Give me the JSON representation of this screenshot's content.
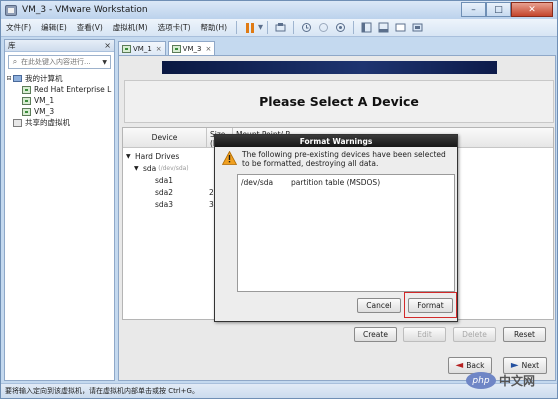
{
  "window": {
    "title": "VM_3 - VMware Workstation",
    "min_glyph": "–",
    "max_glyph": "□",
    "close_glyph": "✕"
  },
  "menu": [
    "文件(F)",
    "编辑(E)",
    "查看(V)",
    "虚拟机(M)",
    "选项卡(T)",
    "帮助(H)"
  ],
  "toolbar": {
    "pause_dropdown_glyph": "▾",
    "icons": [
      "send-keys-icon",
      "snapshot-icon",
      "revert-snapshot-icon",
      "manage-snapshots-icon",
      "sidebar-icon",
      "thumbnail-icon",
      "fullscreen-icon",
      "unity-icon"
    ]
  },
  "library": {
    "title": "库",
    "close_glyph": "×",
    "search_placeholder": "在此处键入内容进行...",
    "search_icon_glyph": "⌕",
    "dropdown_glyph": "▼",
    "tree": {
      "root_label": "我的计算机",
      "root_toggle": "⊟",
      "vms": [
        "Red Hat Enterprise L",
        "VM_1",
        "VM_3"
      ],
      "shared_label": "共享的虚拟机"
    }
  },
  "tabs": [
    {
      "label": "VM_1",
      "close": "×"
    },
    {
      "label": "VM_3",
      "close": "×"
    }
  ],
  "installer": {
    "heading": "Please Select A Device",
    "columns": {
      "device": "Device",
      "size": "Size (M",
      "mount": "Mount Point/ R"
    },
    "hard_drives_label": "Hard Drives",
    "disk": {
      "name": "sda",
      "path": "(/dev/sda)"
    },
    "partitions": [
      {
        "name": "sda1",
        "size": ""
      },
      {
        "name": "sda2",
        "size": "2"
      },
      {
        "name": "sda3",
        "size": "38"
      }
    ],
    "buttons": {
      "create": "Create",
      "edit": "Edit",
      "delete": "Delete",
      "reset": "Reset",
      "back": "Back",
      "next": "Next"
    },
    "back_glyph": "◄",
    "next_glyph": "►"
  },
  "dialog": {
    "title": "Format Warnings",
    "message": "The following pre-existing devices have been selected to be formatted, destroying all data.",
    "devices": [
      {
        "device": "/dev/sda",
        "description": "partition table (MSDOS)"
      }
    ],
    "cancel_label": "Cancel",
    "format_label": "Format"
  },
  "status_bar": {
    "text": "要将输入定向到该虚拟机，请在虚拟机内部单击或按 Ctrl+G。"
  },
  "watermark": {
    "logo": "php",
    "text": "中文网"
  }
}
